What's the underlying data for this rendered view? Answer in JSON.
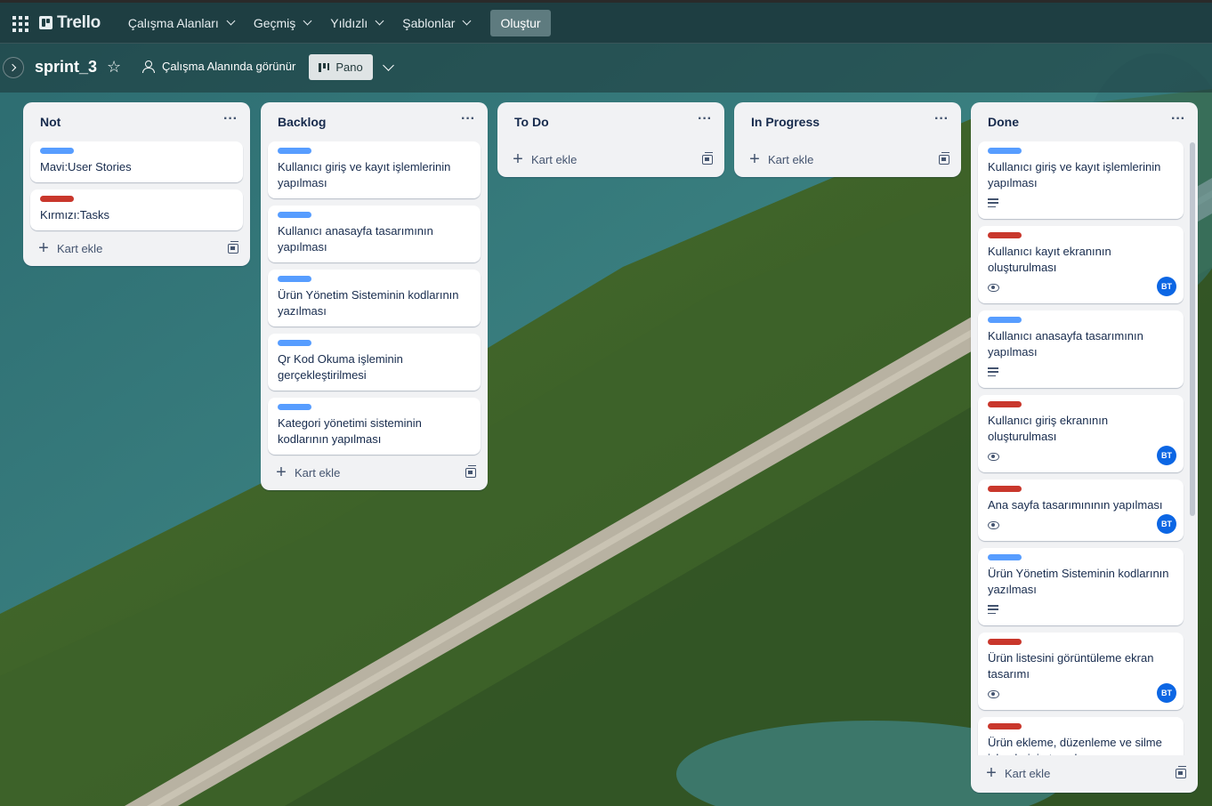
{
  "topbar": {
    "logo": "Trello",
    "nav": [
      "Çalışma Alanları",
      "Geçmiş",
      "Yıldızlı",
      "Şablonlar"
    ],
    "create_label": "Oluştur"
  },
  "board": {
    "title": "sprint_3",
    "visibility": "Çalışma Alanında görünür",
    "view_label": "Pano"
  },
  "colors": {
    "blue_label": "#579dff",
    "red_label": "#c9372c",
    "avatar": "#0c66e4"
  },
  "add_card_label": "Kart ekle",
  "lists": [
    {
      "title": "Not",
      "cards": [
        {
          "label": "blue",
          "text": "Mavi:User Stories"
        },
        {
          "label": "red",
          "text": "Kırmızı:Tasks"
        }
      ]
    },
    {
      "title": "Backlog",
      "cards": [
        {
          "label": "blue",
          "text": "Kullanıcı giriş ve kayıt işlemlerinin yapılması"
        },
        {
          "label": "blue",
          "text": "Kullanıcı anasayfa tasarımının yapılması"
        },
        {
          "label": "blue",
          "text": "Ürün Yönetim Sisteminin kodlarının yazılması"
        },
        {
          "label": "blue",
          "text": "Qr Kod Okuma işleminin gerçekleştirilmesi"
        },
        {
          "label": "blue",
          "text": "Kategori yönetimi sisteminin kodlarının yapılması"
        }
      ]
    },
    {
      "title": "To Do",
      "cards": []
    },
    {
      "title": "In Progress",
      "cards": []
    },
    {
      "title": "Done",
      "cards": [
        {
          "label": "blue",
          "text": "Kullanıcı giriş ve kayıt işlemlerinin yapılması",
          "badge": "description"
        },
        {
          "label": "red",
          "text": "Kullanıcı kayıt ekranının oluşturulması",
          "badge": "watch",
          "member": "BT"
        },
        {
          "label": "blue",
          "text": "Kullanıcı anasayfa tasarımının yapılması",
          "badge": "description"
        },
        {
          "label": "red",
          "text": "Kullanıcı giriş ekranının oluşturulması",
          "badge": "watch",
          "member": "BT"
        },
        {
          "label": "red",
          "text": "Ana sayfa tasarımınının yapılması",
          "badge": "watch",
          "member": "BT"
        },
        {
          "label": "blue",
          "text": "Ürün Yönetim Sisteminin kodlarının yazılması",
          "badge": "description"
        },
        {
          "label": "red",
          "text": "Ürün listesini görüntüleme ekran tasarımı",
          "badge": "watch",
          "member": "BT"
        },
        {
          "label": "red",
          "text": "Ürün ekleme, düzenleme ve silme işlemlerinin tasarlanması"
        }
      ]
    }
  ]
}
